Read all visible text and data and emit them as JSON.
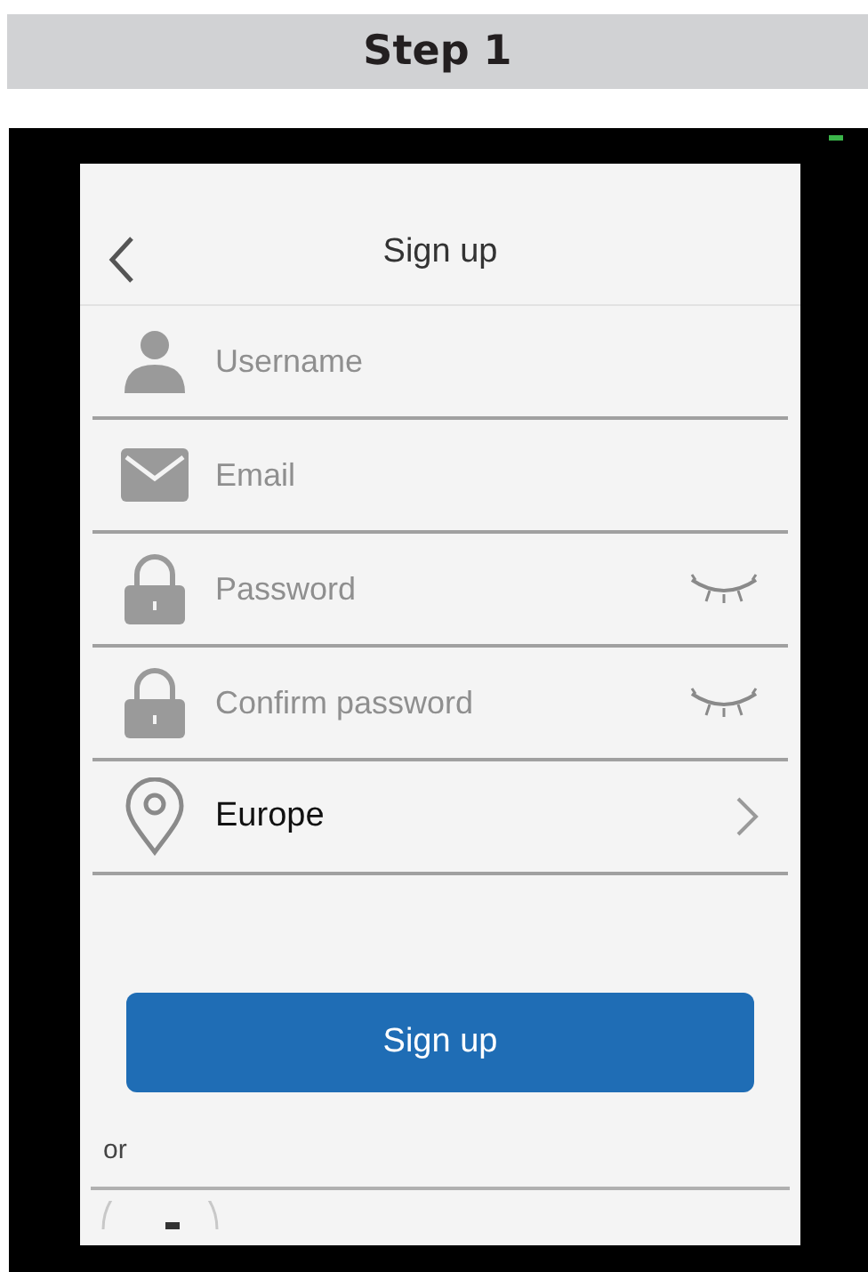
{
  "step_title": "Step 1",
  "screen": {
    "title": "Sign up",
    "fields": [
      {
        "kind": "username",
        "placeholder": "Username"
      },
      {
        "kind": "email",
        "placeholder": "Email"
      },
      {
        "kind": "password",
        "placeholder": "Password"
      },
      {
        "kind": "password",
        "placeholder": "Confirm password"
      },
      {
        "kind": "region",
        "value": "Europe"
      }
    ],
    "submit": "Sign up",
    "separator": "or"
  }
}
